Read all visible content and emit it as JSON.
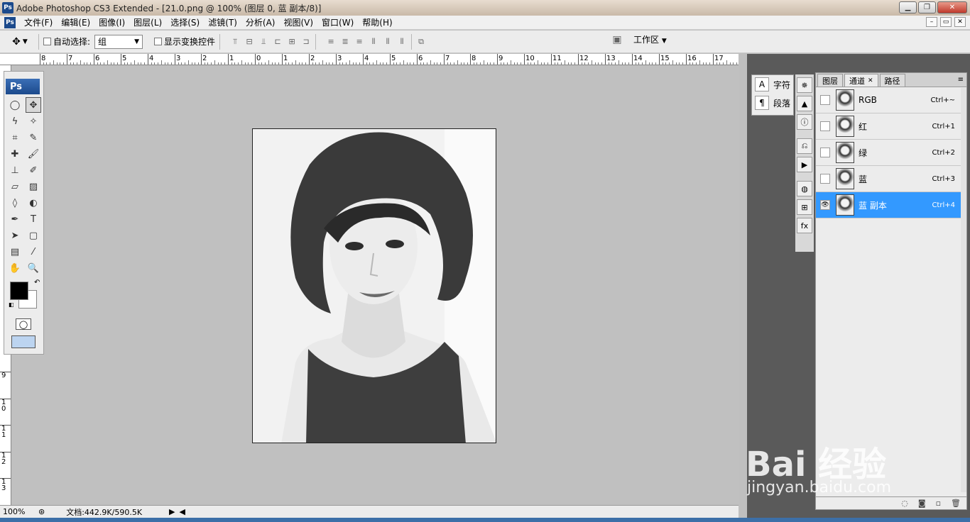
{
  "window": {
    "app_icon": "Ps",
    "title": "Adobe Photoshop CS3 Extended - [21.0.png @ 100% (图层 0, 蓝 副本/8)]",
    "minimize_label": "▁",
    "maximize_label": "❐",
    "close_label": "✕"
  },
  "menu": {
    "items": [
      "文件(F)",
      "编辑(E)",
      "图像(I)",
      "图层(L)",
      "选择(S)",
      "滤镜(T)",
      "分析(A)",
      "视图(V)",
      "窗口(W)",
      "帮助(H)"
    ],
    "doc_minimize": "–",
    "doc_restore": "▭",
    "doc_close": "✕"
  },
  "options": {
    "auto_select_label": "自动选择:",
    "auto_select_value": "组",
    "show_transform_label": "显示变换控件",
    "workspace_label": "工作区"
  },
  "ruler": {
    "h_labels": [
      "8",
      "7",
      "6",
      "5",
      "4",
      "3",
      "2",
      "1",
      "0",
      "1",
      "2",
      "3",
      "4",
      "5",
      "6",
      "7",
      "8",
      "9",
      "10",
      "11",
      "12",
      "13",
      "14",
      "15",
      "16",
      "17"
    ],
    "v_labels": [
      "9",
      "1\n0",
      "1\n1",
      "1\n2",
      "1\n3"
    ]
  },
  "toolbox": {
    "logo": "Ps"
  },
  "status": {
    "zoom": "100%",
    "doc_info": "文档:442.9K/590.5K"
  },
  "mini_panel": {
    "character_label": "字符",
    "paragraph_label": "段落"
  },
  "channels_panel": {
    "tabs": [
      {
        "label": "图层"
      },
      {
        "label": "通道"
      },
      {
        "label": "路径"
      }
    ],
    "channels": [
      {
        "name": "RGB",
        "shortcut": "Ctrl+~"
      },
      {
        "name": "红",
        "shortcut": "Ctrl+1"
      },
      {
        "name": "绿",
        "shortcut": "Ctrl+2"
      },
      {
        "name": "蓝",
        "shortcut": "Ctrl+3"
      },
      {
        "name": "蓝 副本",
        "shortcut": "Ctrl+4"
      }
    ]
  },
  "watermark": {
    "brand": "Bai 经验",
    "url": "jingyan.baidu.com"
  }
}
